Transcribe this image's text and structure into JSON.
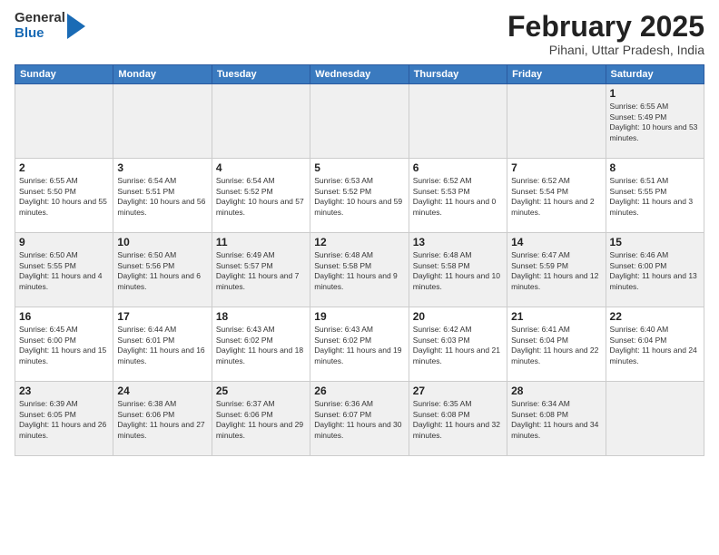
{
  "header": {
    "logo": {
      "general": "General",
      "blue": "Blue"
    },
    "title": "February 2025",
    "location": "Pihani, Uttar Pradesh, India"
  },
  "days_of_week": [
    "Sunday",
    "Monday",
    "Tuesday",
    "Wednesday",
    "Thursday",
    "Friday",
    "Saturday"
  ],
  "weeks": [
    [
      {
        "day": "",
        "info": ""
      },
      {
        "day": "",
        "info": ""
      },
      {
        "day": "",
        "info": ""
      },
      {
        "day": "",
        "info": ""
      },
      {
        "day": "",
        "info": ""
      },
      {
        "day": "",
        "info": ""
      },
      {
        "day": "1",
        "info": "Sunrise: 6:55 AM\nSunset: 5:49 PM\nDaylight: 10 hours and 53 minutes."
      }
    ],
    [
      {
        "day": "2",
        "info": "Sunrise: 6:55 AM\nSunset: 5:50 PM\nDaylight: 10 hours and 55 minutes."
      },
      {
        "day": "3",
        "info": "Sunrise: 6:54 AM\nSunset: 5:51 PM\nDaylight: 10 hours and 56 minutes."
      },
      {
        "day": "4",
        "info": "Sunrise: 6:54 AM\nSunset: 5:52 PM\nDaylight: 10 hours and 57 minutes."
      },
      {
        "day": "5",
        "info": "Sunrise: 6:53 AM\nSunset: 5:52 PM\nDaylight: 10 hours and 59 minutes."
      },
      {
        "day": "6",
        "info": "Sunrise: 6:52 AM\nSunset: 5:53 PM\nDaylight: 11 hours and 0 minutes."
      },
      {
        "day": "7",
        "info": "Sunrise: 6:52 AM\nSunset: 5:54 PM\nDaylight: 11 hours and 2 minutes."
      },
      {
        "day": "8",
        "info": "Sunrise: 6:51 AM\nSunset: 5:55 PM\nDaylight: 11 hours and 3 minutes."
      }
    ],
    [
      {
        "day": "9",
        "info": "Sunrise: 6:50 AM\nSunset: 5:55 PM\nDaylight: 11 hours and 4 minutes."
      },
      {
        "day": "10",
        "info": "Sunrise: 6:50 AM\nSunset: 5:56 PM\nDaylight: 11 hours and 6 minutes."
      },
      {
        "day": "11",
        "info": "Sunrise: 6:49 AM\nSunset: 5:57 PM\nDaylight: 11 hours and 7 minutes."
      },
      {
        "day": "12",
        "info": "Sunrise: 6:48 AM\nSunset: 5:58 PM\nDaylight: 11 hours and 9 minutes."
      },
      {
        "day": "13",
        "info": "Sunrise: 6:48 AM\nSunset: 5:58 PM\nDaylight: 11 hours and 10 minutes."
      },
      {
        "day": "14",
        "info": "Sunrise: 6:47 AM\nSunset: 5:59 PM\nDaylight: 11 hours and 12 minutes."
      },
      {
        "day": "15",
        "info": "Sunrise: 6:46 AM\nSunset: 6:00 PM\nDaylight: 11 hours and 13 minutes."
      }
    ],
    [
      {
        "day": "16",
        "info": "Sunrise: 6:45 AM\nSunset: 6:00 PM\nDaylight: 11 hours and 15 minutes."
      },
      {
        "day": "17",
        "info": "Sunrise: 6:44 AM\nSunset: 6:01 PM\nDaylight: 11 hours and 16 minutes."
      },
      {
        "day": "18",
        "info": "Sunrise: 6:43 AM\nSunset: 6:02 PM\nDaylight: 11 hours and 18 minutes."
      },
      {
        "day": "19",
        "info": "Sunrise: 6:43 AM\nSunset: 6:02 PM\nDaylight: 11 hours and 19 minutes."
      },
      {
        "day": "20",
        "info": "Sunrise: 6:42 AM\nSunset: 6:03 PM\nDaylight: 11 hours and 21 minutes."
      },
      {
        "day": "21",
        "info": "Sunrise: 6:41 AM\nSunset: 6:04 PM\nDaylight: 11 hours and 22 minutes."
      },
      {
        "day": "22",
        "info": "Sunrise: 6:40 AM\nSunset: 6:04 PM\nDaylight: 11 hours and 24 minutes."
      }
    ],
    [
      {
        "day": "23",
        "info": "Sunrise: 6:39 AM\nSunset: 6:05 PM\nDaylight: 11 hours and 26 minutes."
      },
      {
        "day": "24",
        "info": "Sunrise: 6:38 AM\nSunset: 6:06 PM\nDaylight: 11 hours and 27 minutes."
      },
      {
        "day": "25",
        "info": "Sunrise: 6:37 AM\nSunset: 6:06 PM\nDaylight: 11 hours and 29 minutes."
      },
      {
        "day": "26",
        "info": "Sunrise: 6:36 AM\nSunset: 6:07 PM\nDaylight: 11 hours and 30 minutes."
      },
      {
        "day": "27",
        "info": "Sunrise: 6:35 AM\nSunset: 6:08 PM\nDaylight: 11 hours and 32 minutes."
      },
      {
        "day": "28",
        "info": "Sunrise: 6:34 AM\nSunset: 6:08 PM\nDaylight: 11 hours and 34 minutes."
      },
      {
        "day": "",
        "info": ""
      }
    ]
  ]
}
